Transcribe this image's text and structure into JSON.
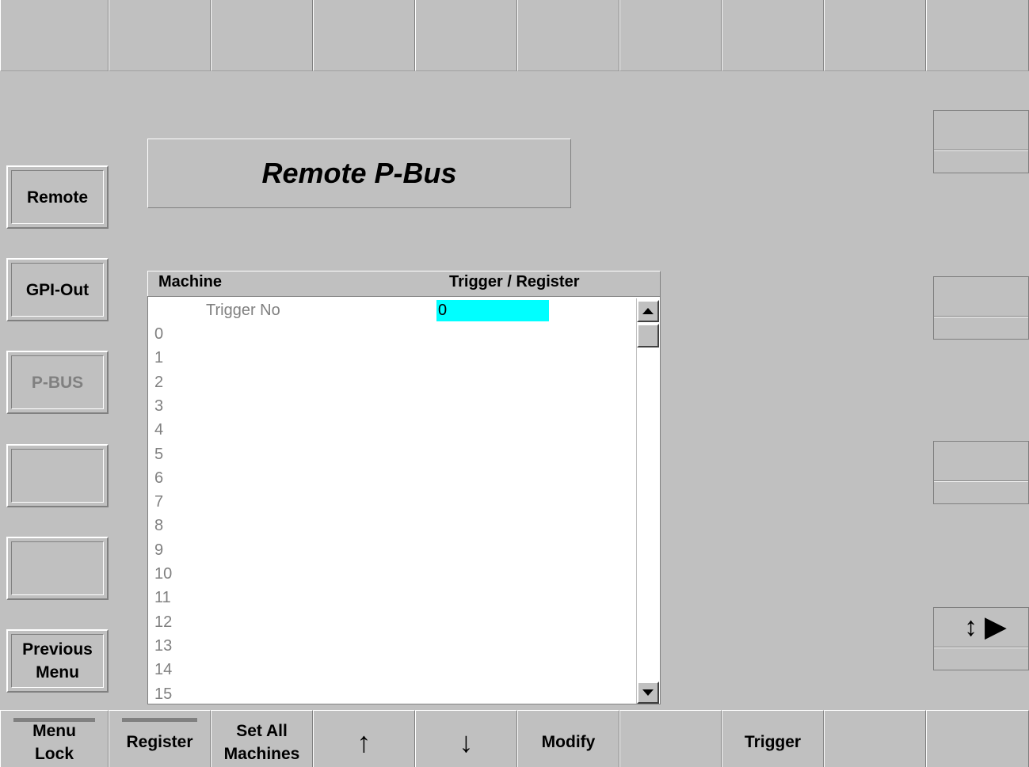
{
  "page": {
    "title": "Remote P-Bus"
  },
  "left_menu": {
    "remote": "Remote",
    "gpi_out": "GPI-Out",
    "p_bus": "P-BUS",
    "empty_1": "",
    "empty_2": "",
    "previous_menu": "Previous Menu"
  },
  "table": {
    "columns": [
      "Machine",
      "Trigger / Register"
    ],
    "trigger_label": "Trigger No",
    "trigger_value": "0",
    "rows": [
      "0",
      "1",
      "2",
      "3",
      "4",
      "5",
      "6",
      "7",
      "8",
      "9",
      "10",
      "11",
      "12",
      "13",
      "14",
      "15"
    ]
  },
  "right_panel": {
    "arrows_label": "↕ ▶"
  },
  "bottom_bar": {
    "menu_lock": "Menu Lock",
    "register": "Register",
    "set_all_machines": "Set All Machines",
    "up": "↑",
    "down": "↓",
    "modify": "Modify",
    "empty_a": "",
    "trigger": "Trigger",
    "empty_b": "",
    "empty_c": ""
  },
  "colors": {
    "background": "#c0c0c0",
    "list_background": "#ffffff",
    "selected_cell": "#00ffff",
    "dim_text": "#808080"
  }
}
